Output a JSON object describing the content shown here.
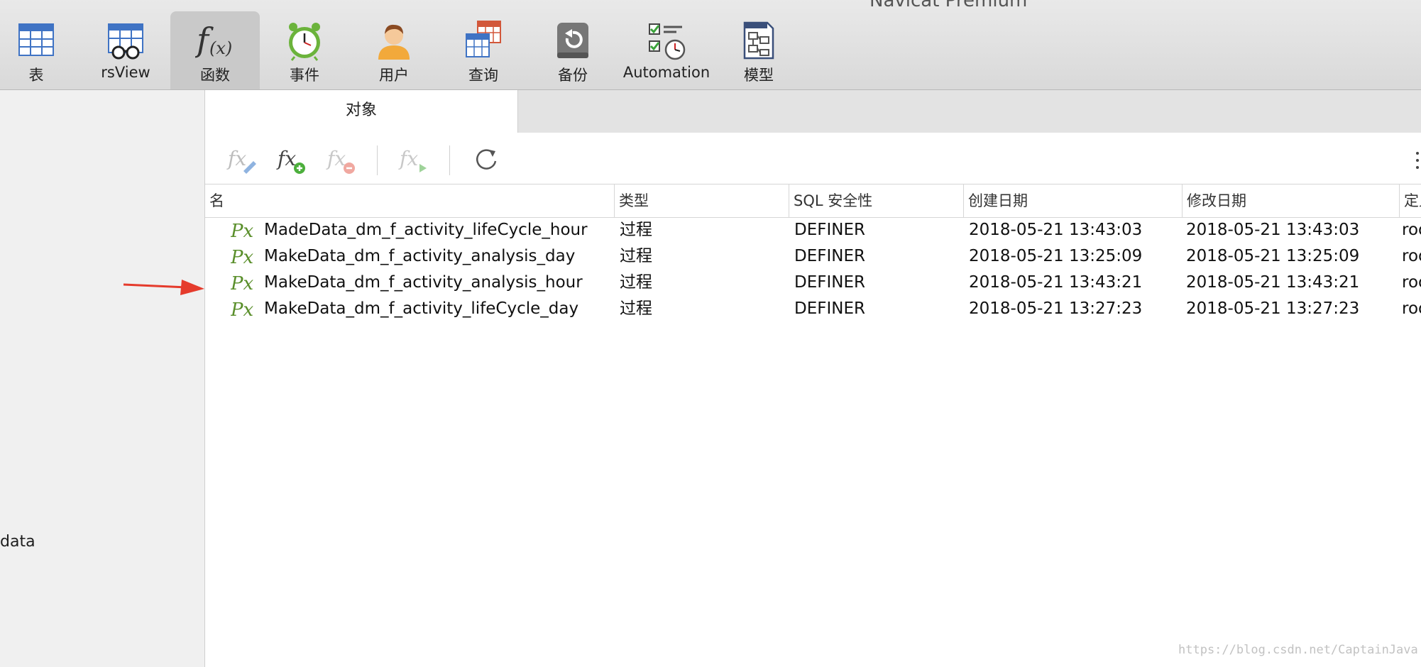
{
  "window": {
    "title": "Navicat Premium"
  },
  "toolbar": {
    "buttons": [
      {
        "label": "表",
        "icon": "table-icon"
      },
      {
        "label": "rsView",
        "icon": "view-icon"
      },
      {
        "label": "函数",
        "icon": "function-icon",
        "selected": true
      },
      {
        "label": "事件",
        "icon": "event-clock-icon"
      },
      {
        "label": "用户",
        "icon": "user-icon"
      },
      {
        "label": "查询",
        "icon": "query-icon"
      },
      {
        "label": "备份",
        "icon": "backup-icon"
      },
      {
        "label": "Automation",
        "icon": "automation-icon"
      },
      {
        "label": "模型",
        "icon": "model-icon"
      }
    ]
  },
  "sidebar": {
    "visible_item": "data"
  },
  "tabs": {
    "object": "对象"
  },
  "object_toolbar": {
    "buttons": [
      "edit-function-icon",
      "new-function-icon",
      "delete-function-icon",
      "run-function-icon",
      "refresh-icon"
    ]
  },
  "table": {
    "columns": [
      "名",
      "类型",
      "SQL 安全性",
      "创建日期",
      "修改日期",
      "定义者"
    ],
    "rows": [
      {
        "name": "MadeData_dm_f_activity_lifeCycle_hour",
        "type": "过程",
        "security": "DEFINER",
        "created": "2018-05-21 13:43:03",
        "modified": "2018-05-21 13:43:03",
        "definer": "root"
      },
      {
        "name": "MakeData_dm_f_activity_analysis_day",
        "type": "过程",
        "security": "DEFINER",
        "created": "2018-05-21 13:25:09",
        "modified": "2018-05-21 13:25:09",
        "definer": "root"
      },
      {
        "name": "MakeData_dm_f_activity_analysis_hour",
        "type": "过程",
        "security": "DEFINER",
        "created": "2018-05-21 13:43:21",
        "modified": "2018-05-21 13:43:21",
        "definer": "root"
      },
      {
        "name": "MakeData_dm_f_activity_lifeCycle_day",
        "type": "过程",
        "security": "DEFINER",
        "created": "2018-05-21 13:27:23",
        "modified": "2018-05-21 13:27:23",
        "definer": "root"
      }
    ]
  },
  "watermark": "https://blog.csdn.net/CaptainJava",
  "colors": {
    "accent_green": "#5a8f2b",
    "arrow_red": "#e53b2c",
    "toolbar_bg": "#e1e1e1"
  }
}
